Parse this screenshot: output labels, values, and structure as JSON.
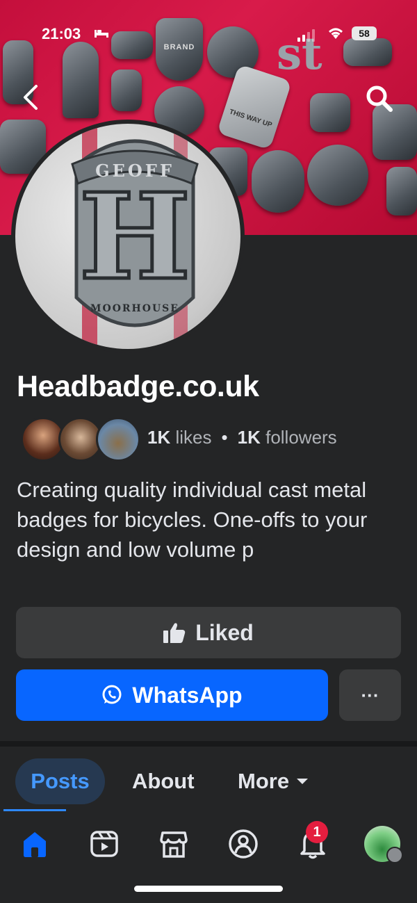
{
  "status_bar": {
    "time": "21:03",
    "battery": "58"
  },
  "profile": {
    "name": "Headbadge.co.uk",
    "likes_count": "1K",
    "likes_label": "likes",
    "followers_count": "1K",
    "followers_label": "followers",
    "bio": "Creating quality individual cast metal badges for bicycles. One-offs to your design and low volume p"
  },
  "cover_badges": {
    "brand": "BRAND",
    "fragile": "THIS WAY UP",
    "st": "st"
  },
  "avatar_badge": {
    "top_text": "GEOFF",
    "letter": "H",
    "bottom_text": "MOORHOUSE"
  },
  "actions": {
    "liked_label": "Liked",
    "whatsapp_label": "WhatsApp",
    "more_label": "···"
  },
  "tabs": [
    {
      "label": "Posts"
    },
    {
      "label": "About"
    },
    {
      "label": "More"
    }
  ],
  "nav": {
    "notifications_badge": "1"
  },
  "colors": {
    "background": "#242526",
    "cover": "#d81b4a",
    "primary_button": "#0866ff",
    "secondary_button": "#3a3b3c",
    "active_tab": "#263951",
    "active_tab_text": "#4599ff",
    "notification_badge": "#e41e3f"
  },
  "icons": [
    "back-icon",
    "search-icon",
    "thumbs-up-icon",
    "whatsapp-icon",
    "caret-down-icon",
    "home-icon",
    "video-icon",
    "marketplace-icon",
    "groups-icon",
    "bell-icon",
    "profile-avatar-icon"
  ]
}
